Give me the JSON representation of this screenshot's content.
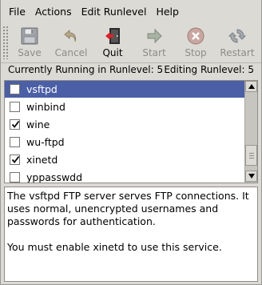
{
  "menubar": {
    "items": [
      {
        "label": "File"
      },
      {
        "label": "Actions"
      },
      {
        "label": "Edit Runlevel"
      },
      {
        "label": "Help"
      }
    ]
  },
  "toolbar": {
    "save_label": "Save",
    "cancel_label": "Cancel",
    "quit_label": "Quit",
    "start_label": "Start",
    "stop_label": "Stop",
    "restart_label": "Restart"
  },
  "status": {
    "running": "Currently Running in Runlevel: 5",
    "editing": "Editing Runlevel: 5"
  },
  "services": [
    {
      "name": "vsftpd",
      "checked": false,
      "selected": true
    },
    {
      "name": "winbind",
      "checked": false,
      "selected": false
    },
    {
      "name": "wine",
      "checked": true,
      "selected": false
    },
    {
      "name": "wu-ftpd",
      "checked": false,
      "selected": false
    },
    {
      "name": "xinetd",
      "checked": true,
      "selected": false
    },
    {
      "name": "yppasswdd",
      "checked": false,
      "selected": false
    }
  ],
  "description": {
    "text": "The vsftpd FTP server serves FTP connections. It uses normal, unencrypted usernames and passwords for authentication.\n\nYou must enable xinetd to use this service."
  },
  "colors": {
    "selection": "#4b5fa6",
    "window_bg": "#dcdad5"
  }
}
